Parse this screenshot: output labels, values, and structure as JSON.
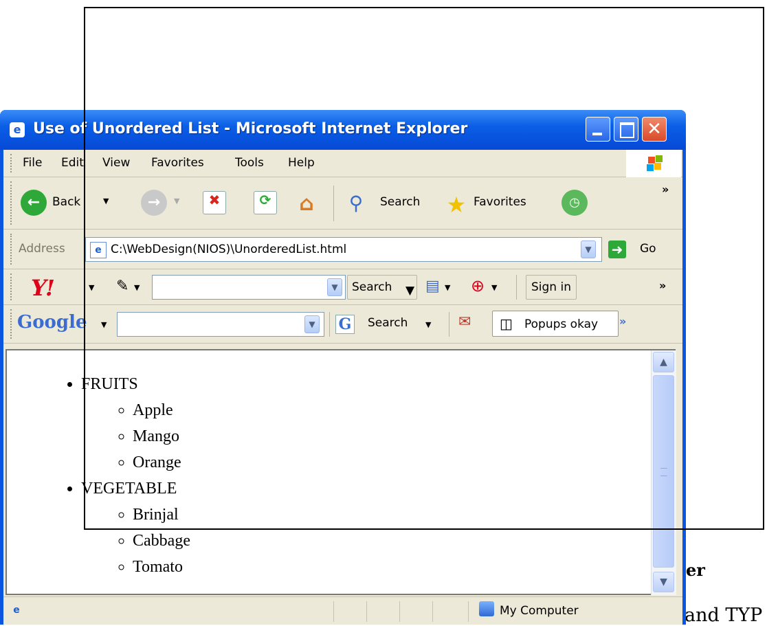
{
  "window": {
    "title": "Use of Unordered List - Microsoft Internet Explorer",
    "min_glyph": "_",
    "close_glyph": "✕"
  },
  "menu": [
    "File",
    "Edit",
    "View",
    "Favorites",
    "Tools",
    "Help"
  ],
  "toolbar": {
    "back_label": "Back",
    "search_label": "Search",
    "favorites_label": "Favorites",
    "overflow": "»"
  },
  "address": {
    "label": "Address",
    "url": "C:\\WebDesign(NIOS)\\UnorderedList.html",
    "go_label": "Go"
  },
  "yahoo": {
    "logo": "Y!",
    "search_label": "Search",
    "signin_label": "Sign in",
    "overflow": "»"
  },
  "google": {
    "logo": "Google",
    "search_label": "Search",
    "popups_label": "Popups okay",
    "overflow": "»"
  },
  "page": {
    "items": [
      {
        "label": "FRUITS",
        "children": [
          "Apple",
          "Mango",
          "Orange"
        ]
      },
      {
        "label": "VEGETABLE",
        "children": [
          "Brinjal",
          "Cabbage",
          "Tomato"
        ]
      }
    ]
  },
  "status": {
    "zone": "My Computer"
  },
  "background_text": {
    "fragment_1": "er",
    "fragment_2": "and TYP"
  },
  "colors": {
    "titlebar": "#0a5fe6",
    "chrome": "#ece9d8",
    "close_button": "#d84a2a",
    "yahoo_red": "#e0001a"
  },
  "icons": [
    "ie-icon",
    "back-icon",
    "forward-icon",
    "stop-icon",
    "refresh-icon",
    "home-icon",
    "search-icon",
    "favorites-icon",
    "history-icon",
    "go-icon",
    "pencil-icon",
    "mail-icon",
    "target-icon",
    "google-search-icon",
    "popup-icon",
    "computer-icon"
  ]
}
